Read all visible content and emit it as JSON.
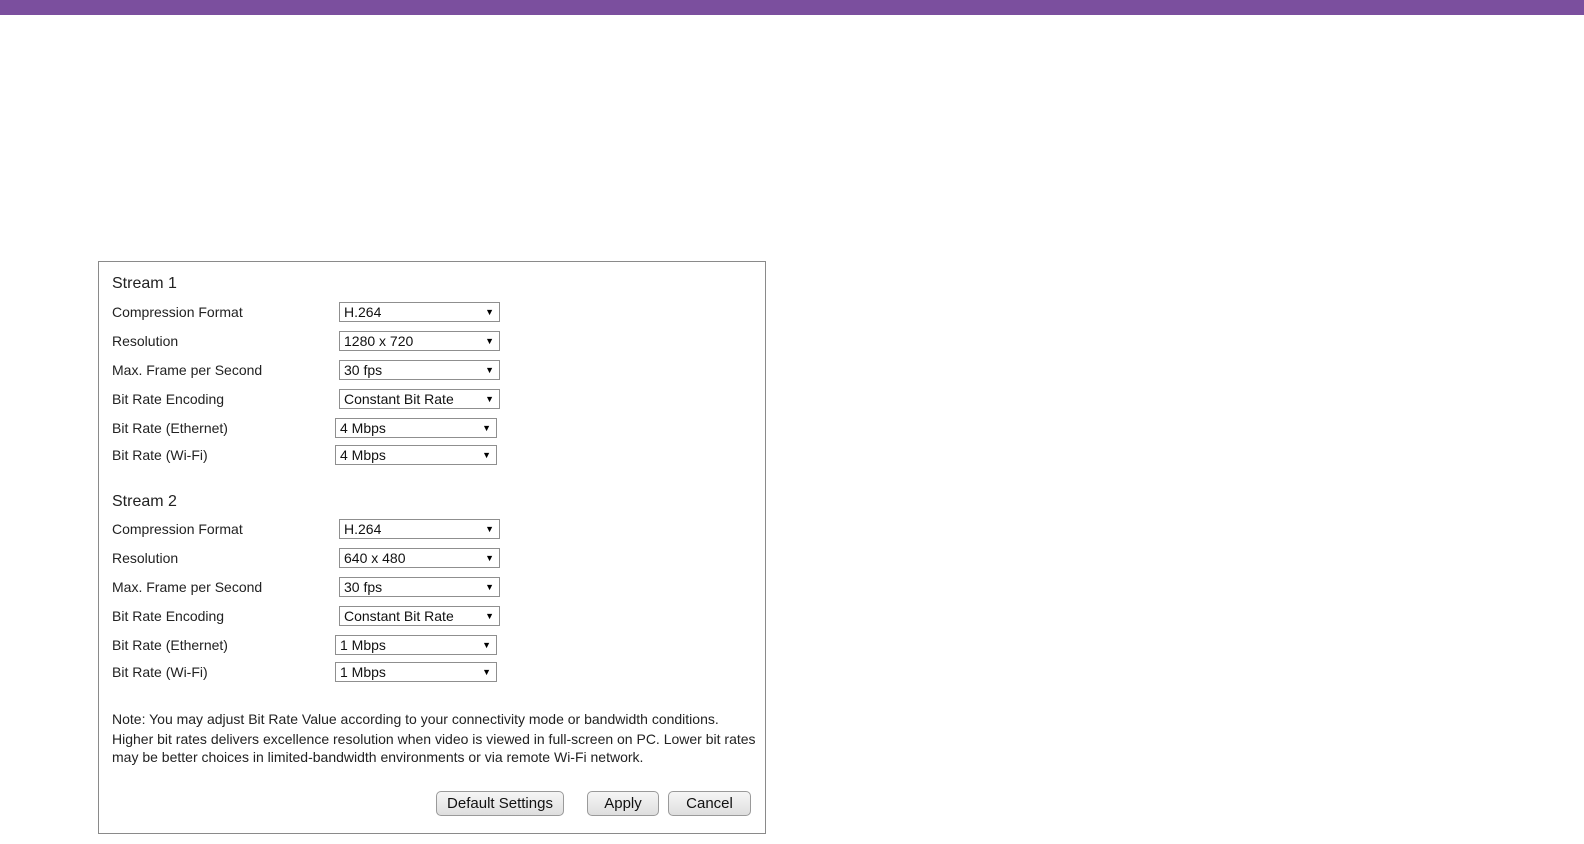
{
  "stream1": {
    "title": "Stream 1",
    "fields": [
      {
        "label": "Compression Format",
        "value": "H.264"
      },
      {
        "label": "Resolution",
        "value": "1280 x 720"
      },
      {
        "label": "Max. Frame per Second",
        "value": "30 fps"
      },
      {
        "label": "Bit Rate Encoding",
        "value": "Constant Bit Rate"
      },
      {
        "label": "Bit Rate (Ethernet)",
        "value": "4 Mbps"
      },
      {
        "label": "Bit Rate (Wi-Fi)",
        "value": "4 Mbps"
      }
    ]
  },
  "stream2": {
    "title": "Stream 2",
    "fields": [
      {
        "label": "Compression Format",
        "value": "H.264"
      },
      {
        "label": "Resolution",
        "value": "640 x 480"
      },
      {
        "label": "Max. Frame per Second",
        "value": "30 fps"
      },
      {
        "label": "Bit Rate Encoding",
        "value": "Constant Bit Rate"
      },
      {
        "label": "Bit Rate (Ethernet)",
        "value": "1 Mbps"
      },
      {
        "label": "Bit Rate (Wi-Fi)",
        "value": "1 Mbps"
      }
    ]
  },
  "note": {
    "line1": "Note: You may adjust Bit Rate Value according to your connectivity mode or bandwidth conditions.",
    "line2": "Higher bit rates delivers excellence resolution when video is viewed in full-screen on PC. Lower bit rates may be better choices in limited-bandwidth environments or via remote Wi-Fi network."
  },
  "buttons": {
    "default_label": "Default Settings",
    "apply_label": "Apply",
    "cancel_label": "Cancel"
  },
  "icons": {
    "dropdown_caret": "chevron-down-icon"
  },
  "colors": {
    "top_bar": "#7b4f9e",
    "panel_border": "#8a8a8a"
  }
}
